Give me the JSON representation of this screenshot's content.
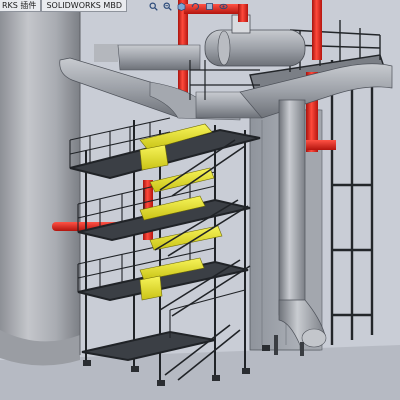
{
  "window": {
    "tabs": [
      {
        "label": "RKS 插件",
        "active": false
      },
      {
        "label": "SOLIDWORKS MBD",
        "active": false
      }
    ]
  },
  "heads_up_toolbar": {
    "icons": [
      "search-icon",
      "zoom-icon",
      "view-orientation-icon",
      "rotate-icon",
      "display-style-icon",
      "hide-show-icon"
    ]
  },
  "viewport": {
    "scene": "industrial-structure-3d-model",
    "colors": {
      "background": "#c9cdd6",
      "steel": "#2a2d31",
      "pipe_gray": "#9a9ea6",
      "pipe_red": "#e8251c",
      "stair_yellow": "#e6e21c",
      "tank": "#a7aab0"
    }
  }
}
